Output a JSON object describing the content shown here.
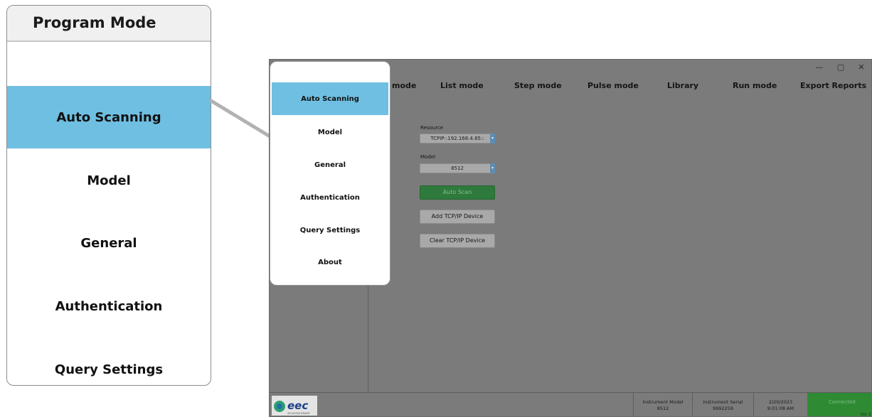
{
  "zoom": {
    "title": "Program Mode",
    "items": [
      {
        "label": "Auto Scanning",
        "active": true
      },
      {
        "label": "Model"
      },
      {
        "label": "General"
      },
      {
        "label": "Authentication"
      },
      {
        "label": "Query Settings"
      }
    ]
  },
  "window": {
    "controls": {
      "minimize": "—",
      "maximize": "▢",
      "close": "✕"
    },
    "tabs": [
      {
        "label": "mode"
      },
      {
        "label": "List mode"
      },
      {
        "label": "Step mode"
      },
      {
        "label": "Pulse mode"
      },
      {
        "label": "Library"
      },
      {
        "label": "Run mode"
      },
      {
        "label": "Export Reports"
      }
    ]
  },
  "form": {
    "resource_label": "Resource",
    "resource_value": "TCPIP::192.168.4.85::",
    "model_label": "Model",
    "model_value": "8512",
    "dropdown_arrow": "▾",
    "auto_scan": "Auto Scan",
    "add_device": "Add TCP/IP Device",
    "clear_device": "Clear TCP/IP Device"
  },
  "status": {
    "logo_text": "eec",
    "logo_sub": "AN IKONIX BRAND",
    "instrument_model_label": "Instrument Model",
    "instrument_model": "8512",
    "instrument_serial_label": "Instrument Serial",
    "instrument_serial": "9992259",
    "date": "2/20/2023",
    "time": "9:01:08 AM",
    "connection": "Connected",
    "version": "Ver 2"
  },
  "popup": {
    "items": [
      {
        "label": "Auto Scanning",
        "active": true
      },
      {
        "label": "Model"
      },
      {
        "label": "General"
      },
      {
        "label": "Authentication"
      },
      {
        "label": "Query Settings"
      },
      {
        "label": "About"
      }
    ]
  },
  "colors": {
    "active_item": "#6fbfe2",
    "app_background": "#7b7b7b",
    "connected_green": "#2f8a34",
    "auto_scan_green": "#2e7a3c"
  }
}
